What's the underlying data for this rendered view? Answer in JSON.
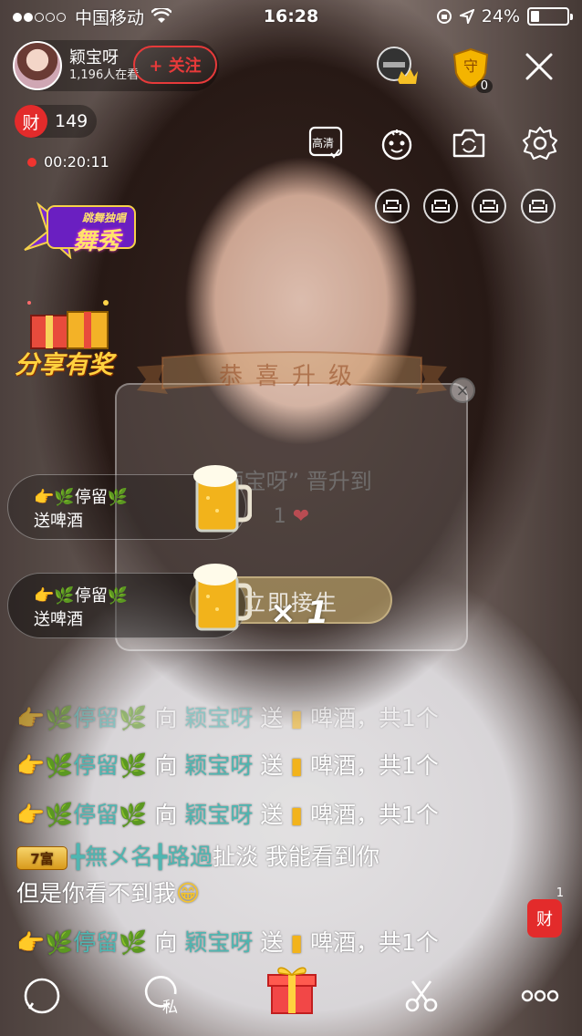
{
  "status_bar": {
    "carrier": "中国移动",
    "time": "16:28",
    "battery": "24%",
    "battery_level": 0.24
  },
  "host": {
    "name": "颖宝呀",
    "viewers": "1,196人在看",
    "follow_label": "+ 关注"
  },
  "wealth": {
    "icon_label": "财",
    "count": "149"
  },
  "live_timer": "00:20:11",
  "promos": {
    "dance_show": "舞秀",
    "dance_tag": "跳舞独唱",
    "share_reward": "分享有奖"
  },
  "top_right": {
    "shield_count": "0",
    "hd_label": "高清"
  },
  "upgrade_popup": {
    "ribbon": "恭喜升级",
    "title": "“颖宝呀” 晋升到",
    "level": "1",
    "button": "立即接生",
    "close": "×"
  },
  "gift_banners": [
    {
      "user": "停留",
      "action": "送啤酒",
      "count": ""
    },
    {
      "user": "停留",
      "action": "送啤酒",
      "count": "× 1"
    }
  ],
  "chat": [
    {
      "user": "停留",
      "verb": "向",
      "nick": "颖宝呀",
      "send": "送",
      "gift": "啤酒，共1个"
    },
    {
      "user": "停留",
      "verb": "向",
      "nick": "颖宝呀",
      "send": "送",
      "gift": "啤酒，共1个"
    },
    {
      "user": "停留",
      "verb": "向",
      "nick": "颖宝呀",
      "send": "送",
      "gift": "啤酒，共1个"
    }
  ],
  "chat_message": {
    "level": "7富",
    "user": "╋無メ名╋路過",
    "text1": "扯淡  我能看到你",
    "text2": "但是你看不到我"
  },
  "chat_last": {
    "user": "停留",
    "verb": "向",
    "nick": "颖宝呀",
    "send": "送",
    "gift": "啤酒，共1个"
  },
  "floating_cai": {
    "label": "财",
    "badge": "1"
  },
  "bottom_bar": {
    "private_label": "私"
  }
}
